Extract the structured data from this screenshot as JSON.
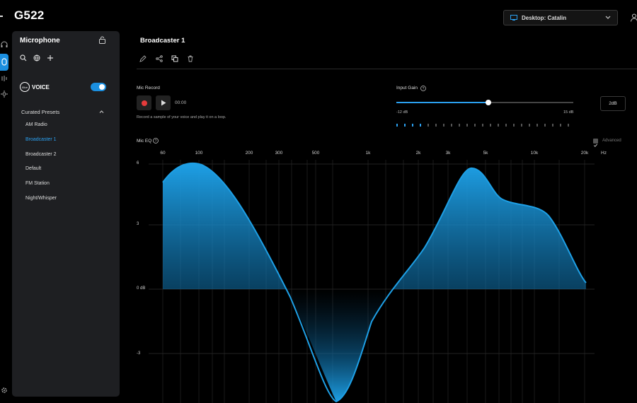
{
  "app": {
    "title": "G522"
  },
  "header": {
    "device_label": "Desktop: Catalin"
  },
  "sidebar": {
    "title": "Microphone",
    "brand": "VOICE",
    "brand_badge": "Blue",
    "presets_heading": "Curated Presets",
    "presets": [
      "AM Radio",
      "Broadcaster 1",
      "Broadcaster 2",
      "Default",
      "FM Station",
      "Night/Whisper"
    ],
    "active_preset": "Broadcaster 1",
    "voice_enabled": true
  },
  "main": {
    "preset_title": "Broadcaster 1",
    "mic_record": {
      "label": "Mic Record",
      "time": "00:00",
      "hint": "Record a sample of your voice and play it on a loop."
    },
    "input_gain": {
      "label": "Input Gain",
      "min_label": "-12 dB",
      "max_label": "15 dB",
      "value_label": "2dB",
      "value_db": 2,
      "min_db": -12,
      "max_db": 15,
      "meter_segments_on": 4
    },
    "mic_eq": {
      "label": "Mic EQ",
      "advanced_label": "Advanced",
      "advanced_checked": true,
      "freq_labels": [
        "60",
        "100",
        "200",
        "300",
        "500",
        "1k",
        "2k",
        "3k",
        "5k",
        "10k",
        "20k",
        "Hz"
      ],
      "level_labels": [
        "6",
        "3",
        "0 dB",
        "-3"
      ],
      "accent": "#1ea0e6"
    }
  }
}
